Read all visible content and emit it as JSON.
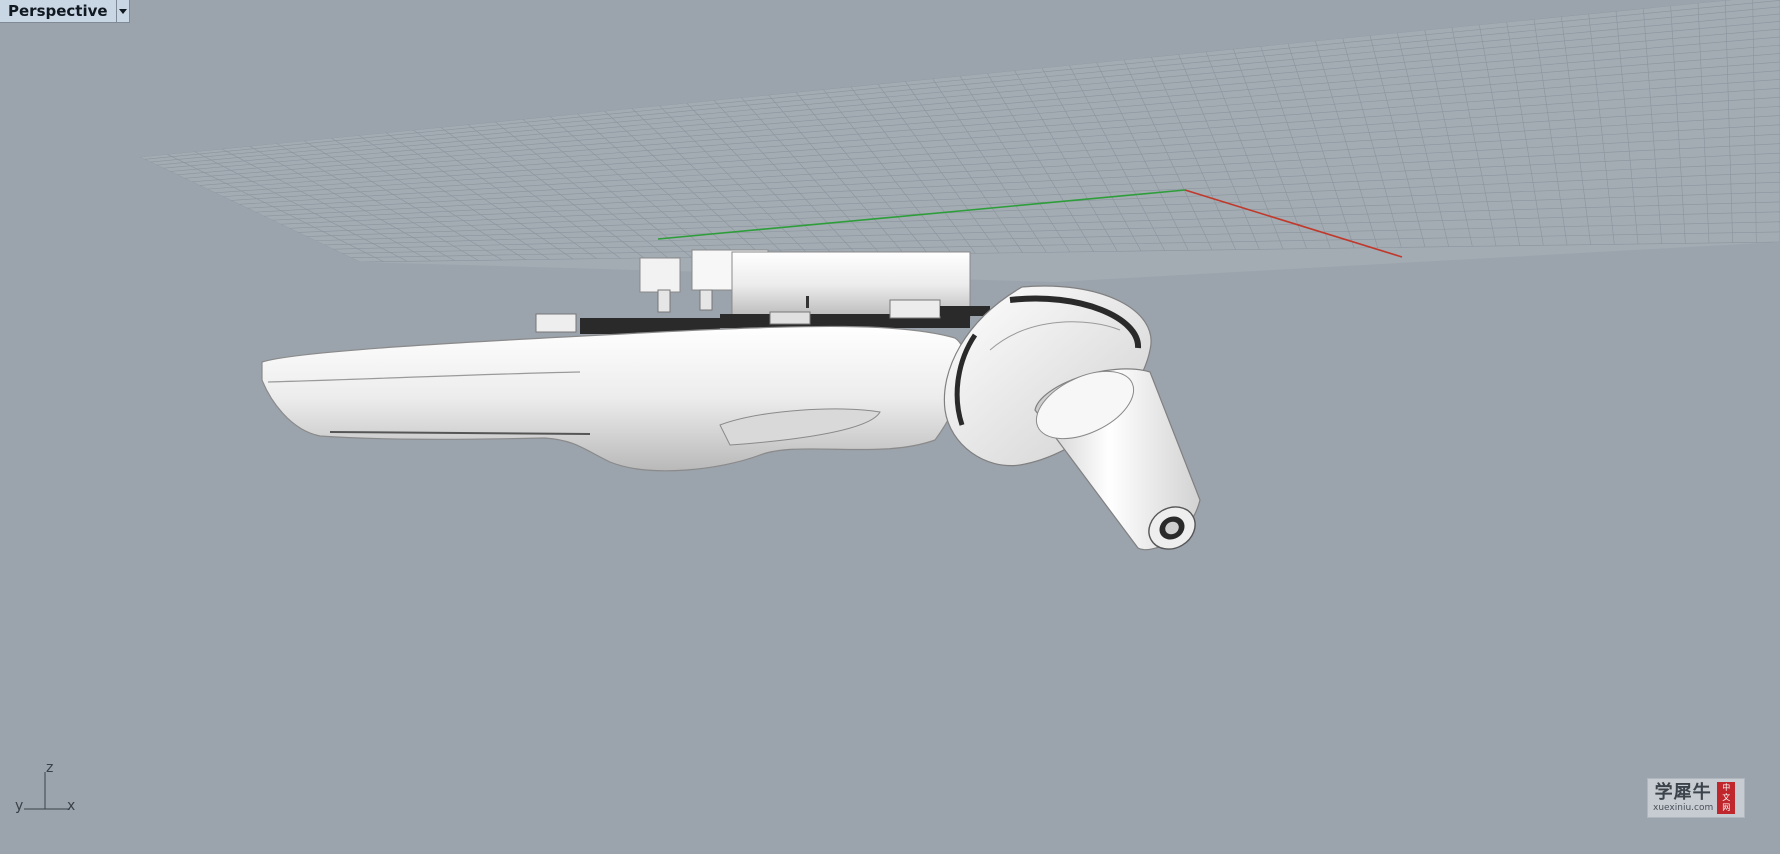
{
  "viewport": {
    "title": "Perspective",
    "dropdown_icon": "chevron-down-icon"
  },
  "axis": {
    "z": "z",
    "y": "y",
    "x": "x"
  },
  "watermark": {
    "main": "学犀牛",
    "sub": "xuexiniu.com",
    "badge": [
      "中",
      "文",
      "网"
    ]
  },
  "colors": {
    "background": "#9ba3ac",
    "grid_line": "#8a939c",
    "x_axis": "#c0392b",
    "y_axis": "#2e9e3a",
    "model_light": "#f4f4f4",
    "model_shadow": "#a8a8a8"
  }
}
